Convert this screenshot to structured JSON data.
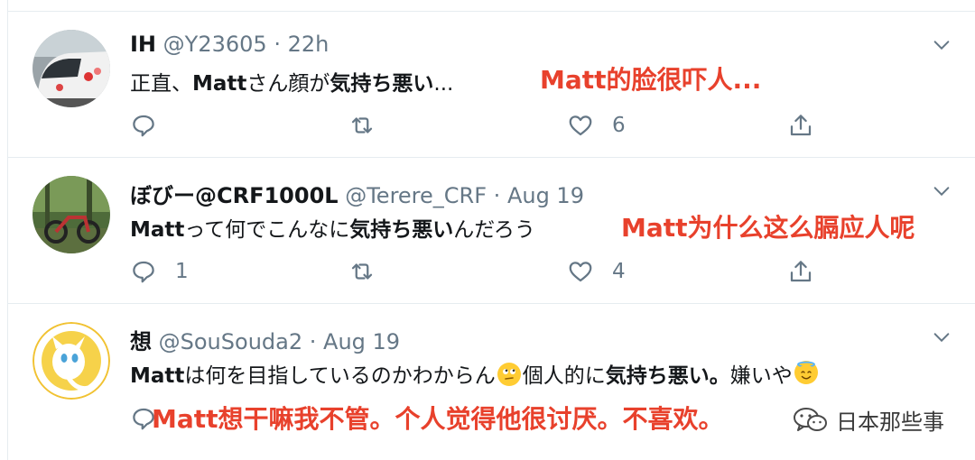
{
  "tweets": [
    {
      "name": "IH",
      "handle": "@Y23605",
      "separator": "·",
      "time": "22h",
      "text_parts": [
        "正直、",
        "Matt",
        "さん顔が",
        "気持ち悪い",
        "..."
      ],
      "overlay": "Matt的脸很吓人...",
      "replies": "",
      "retweets": "",
      "likes": "6",
      "avatar_icon": "train-photo"
    },
    {
      "name": "ぼびー@CRF1000L",
      "handle": "@Terere_CRF",
      "separator": "·",
      "time": "Aug 19",
      "text_parts": [
        "Matt",
        "って何でこんなに",
        "気持ち悪い",
        "んだろう"
      ],
      "overlay": "Matt为什么这么膈应人呢",
      "replies": "1",
      "retweets": "",
      "likes": "4",
      "avatar_icon": "motorcycle-forest-photo"
    },
    {
      "name": "想",
      "handle": "@SouSouda2",
      "separator": "·",
      "time": "Aug 19",
      "text_parts": [
        "Matt",
        "は何を目指しているのかわからん",
        "個人的に",
        "気持ち悪い。",
        "嫌いや"
      ],
      "overlay": "Matt想干嘛我不管。个人觉得他很讨厌。不喜欢。",
      "avatar_icon": "mew-character-avatar"
    }
  ],
  "watermark": {
    "text": "日本那些事",
    "icon": "wechat-icon"
  },
  "colors": {
    "accent_red": "#e8412c",
    "muted": "#657786",
    "divider": "#e6ecf0"
  },
  "icons": [
    "reply-icon",
    "retweet-icon",
    "like-icon",
    "share-icon",
    "chevron-down-icon",
    "rolling-eyes-emoji",
    "halo-smile-emoji"
  ]
}
